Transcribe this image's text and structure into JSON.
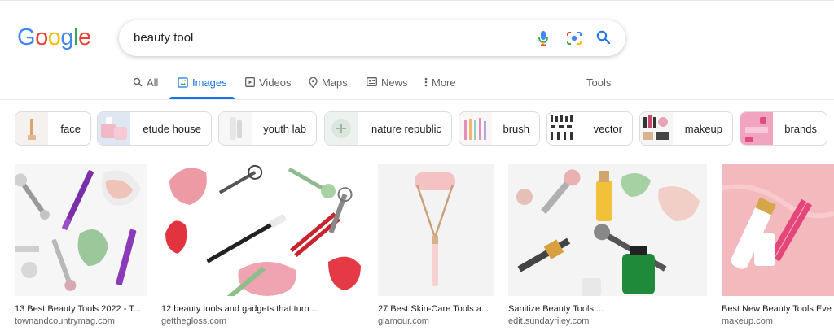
{
  "logo": {
    "letters": [
      "G",
      "o",
      "o",
      "g",
      "l",
      "e"
    ],
    "colors": [
      "#4285F4",
      "#EA4335",
      "#FBBC05",
      "#4285F4",
      "#34A853",
      "#EA4335"
    ]
  },
  "search": {
    "query": "beauty tool"
  },
  "tabs": [
    {
      "label": "All",
      "icon": "search-icon"
    },
    {
      "label": "Images",
      "icon": "image-icon",
      "active": true
    },
    {
      "label": "Videos",
      "icon": "play-icon"
    },
    {
      "label": "Maps",
      "icon": "map-pin-icon"
    },
    {
      "label": "News",
      "icon": "news-icon"
    },
    {
      "label": "More",
      "icon": "more-vert-icon"
    }
  ],
  "tools_label": "Tools",
  "chips": [
    {
      "label": "face"
    },
    {
      "label": "etude house"
    },
    {
      "label": "youth lab"
    },
    {
      "label": "nature republic"
    },
    {
      "label": "brush"
    },
    {
      "label": "vector"
    },
    {
      "label": "makeup"
    },
    {
      "label": "brands"
    }
  ],
  "results": [
    {
      "title": "13 Best Beauty Tools 2022 - T...",
      "source": "townandcountrymag.com"
    },
    {
      "title": "12 beauty tools and gadgets that turn ...",
      "source": "getthegloss.com"
    },
    {
      "title": "27 Best Skin-Care Tools a...",
      "source": "glamour.com"
    },
    {
      "title": "Sanitize Beauty Tools ...",
      "source": "edit.sundayriley.com"
    },
    {
      "title": "Best New Beauty Tools Eve",
      "source": "makeup.com"
    }
  ],
  "colors": {
    "accent": "#1a73e8",
    "muted": "#5f6368",
    "text": "#202124",
    "border": "#dadce0"
  }
}
